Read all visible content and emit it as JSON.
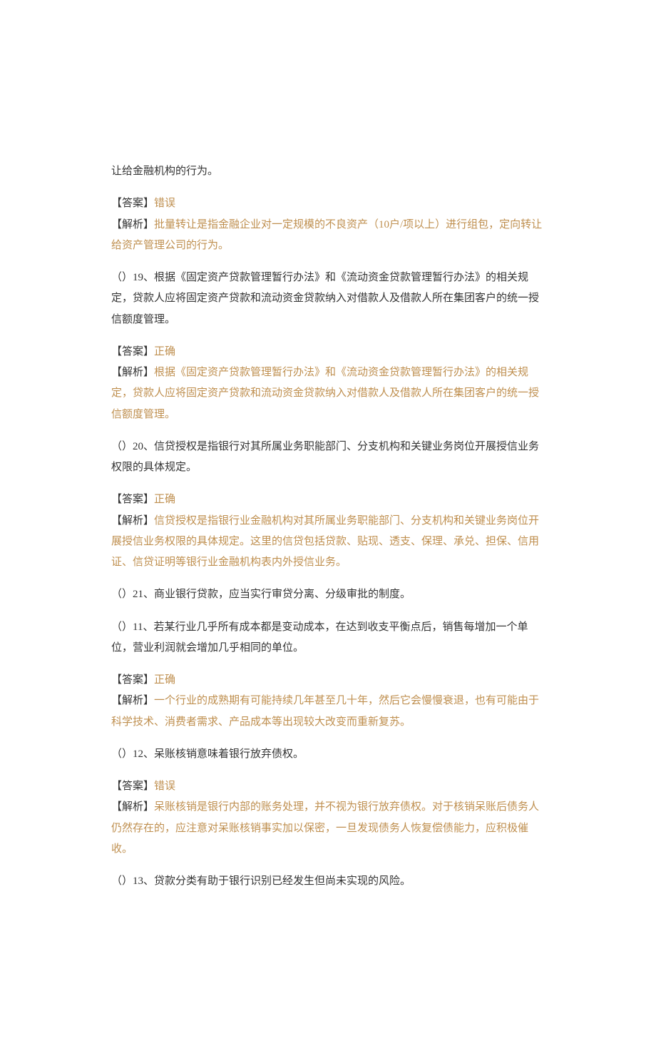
{
  "para1": "让给金融机构的行为。",
  "q18": {
    "answer_label": "【答案】",
    "answer_value": "错误",
    "analysis_label": "【解析】",
    "analysis_text": "批量转让是指金融企业对一定规模的不良资产（10户/项以上）进行组包，定向转让给资产管理公司的行为。"
  },
  "q19": {
    "question": "（）19、根据《固定资产贷款管理暂行办法》和《流动资金贷款管理暂行办法》的相关规定，贷款人应将固定资产贷款和流动资金贷款纳入对借款人及借款人所在集团客户的统一授信额度管理。",
    "answer_label": "【答案】",
    "answer_value": "正确",
    "analysis_label": "【解析】",
    "analysis_text": "根据《固定资产贷款管理暂行办法》和《流动资金贷款管理暂行办法》的相关规定，贷款人应将固定资产贷款和流动资金贷款纳入对借款人及借款人所在集团客户的统一授信额度管理。"
  },
  "q20": {
    "question": "（）20、信贷授权是指银行对其所属业务职能部门、分支机构和关键业务岗位开展授信业务权限的具体规定。",
    "answer_label": "【答案】",
    "answer_value": "正确",
    "analysis_label": "【解析】",
    "analysis_text": "信贷授权是指银行业金融机构对其所属业务职能部门、分支机构和关键业务岗位开展授信业务权限的具体规定。这里的信贷包括贷款、贴现、透支、保理、承兑、担保、信用证、信贷证明等银行业金融机构表内外授信业务。"
  },
  "q21": {
    "question": "（）21、商业银行贷款，应当实行审贷分离、分级审批的制度。"
  },
  "q11": {
    "question": "（）11、若某行业几乎所有成本都是变动成本，在达到收支平衡点后，销售每增加一个单位，营业利润就会增加几乎相同的单位。",
    "answer_label": "【答案】",
    "answer_value": "正确",
    "analysis_label": "【解析】",
    "analysis_text": "一个行业的成熟期有可能持续几年甚至几十年，然后它会慢慢衰退，也有可能由于科学技术、消费者需求、产品成本等出现较大改变而重新复苏。"
  },
  "q12": {
    "question": "（）12、呆账核销意味着银行放弃债权。",
    "answer_label": "【答案】",
    "answer_value": "错误",
    "analysis_label": "【解析】",
    "analysis_text": "呆账核销是银行内部的账务处理，并不视为银行放弃债权。对于核销呆账后债务人仍然存在的，应注意对呆账核销事实加以保密，一旦发现债务人恢复偿债能力，应积极催收。"
  },
  "q13": {
    "question": "（）13、贷款分类有助于银行识别已经发生但尚未实现的风险。"
  }
}
